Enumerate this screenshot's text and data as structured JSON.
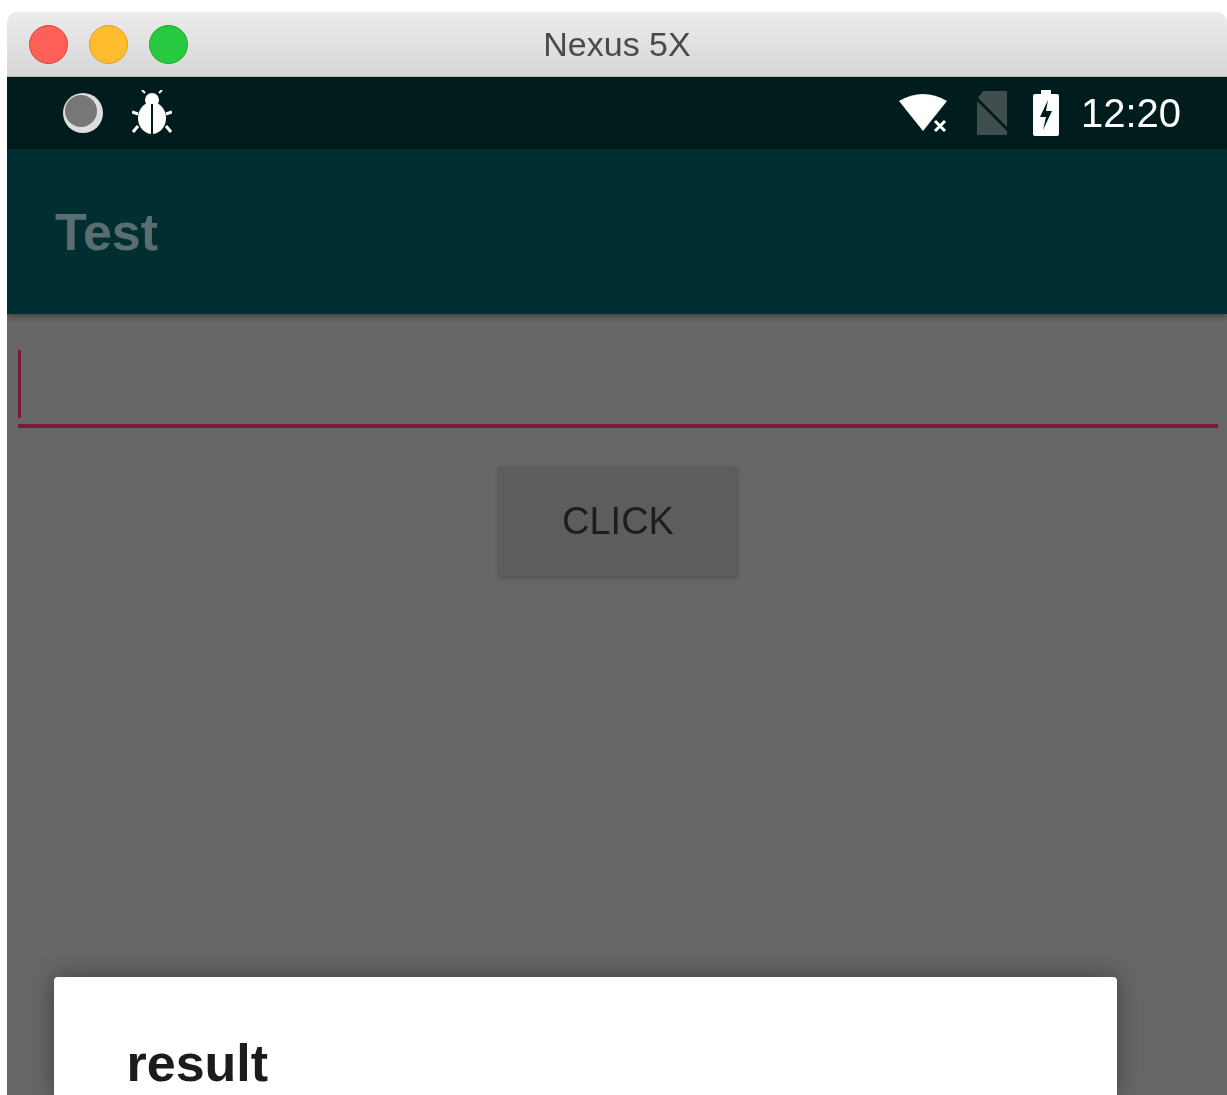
{
  "window": {
    "title": "Nexus 5X"
  },
  "status_bar": {
    "time": "12:20"
  },
  "app_bar": {
    "title": "Test"
  },
  "text_field": {
    "focused": true
  },
  "button": {
    "label": "CLICK"
  },
  "dialog": {
    "title": "result"
  }
}
